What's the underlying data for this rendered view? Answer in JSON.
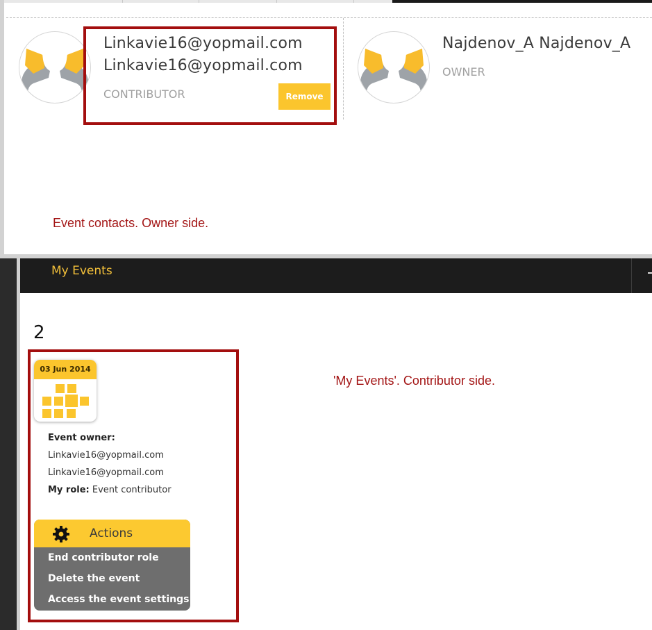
{
  "contacts_panel": {
    "contacts": [
      {
        "name_line1": "Linkavie16@yopmail.com",
        "name_line2": "Linkavie16@yopmail.com",
        "role": "CONTRIBUTOR",
        "remove_label": "Remove"
      },
      {
        "name_line1": "Najdenov_A Najdenov_A",
        "role": "OWNER"
      }
    ],
    "annotation": "Event contacts. Owner side."
  },
  "nav": {
    "my_events_label": "My Events"
  },
  "events_panel": {
    "step_number": "2",
    "annotation": "'My Events'. Contributor side.",
    "event_card": {
      "date": "03 Jun 2014",
      "owner_label": "Event owner:",
      "owner_line1": "Linkavie16@yopmail.com",
      "owner_line2": "Linkavie16@yopmail.com",
      "role_label": "My role:",
      "role_value": " Event contributor"
    },
    "actions": {
      "title": "Actions",
      "items": [
        "End contributor role",
        "Delete the event",
        "Access the event settings"
      ]
    }
  },
  "colors": {
    "accent_yellow": "#fbc52d",
    "highlight_red": "#a30e0e",
    "annotation_red": "#a31515",
    "nav_dark": "#1c1c1c",
    "menu_gray": "#6e6e6e"
  },
  "icons": [
    "user-avatar-icon",
    "calendar-grid-icon",
    "gear-icon"
  ]
}
